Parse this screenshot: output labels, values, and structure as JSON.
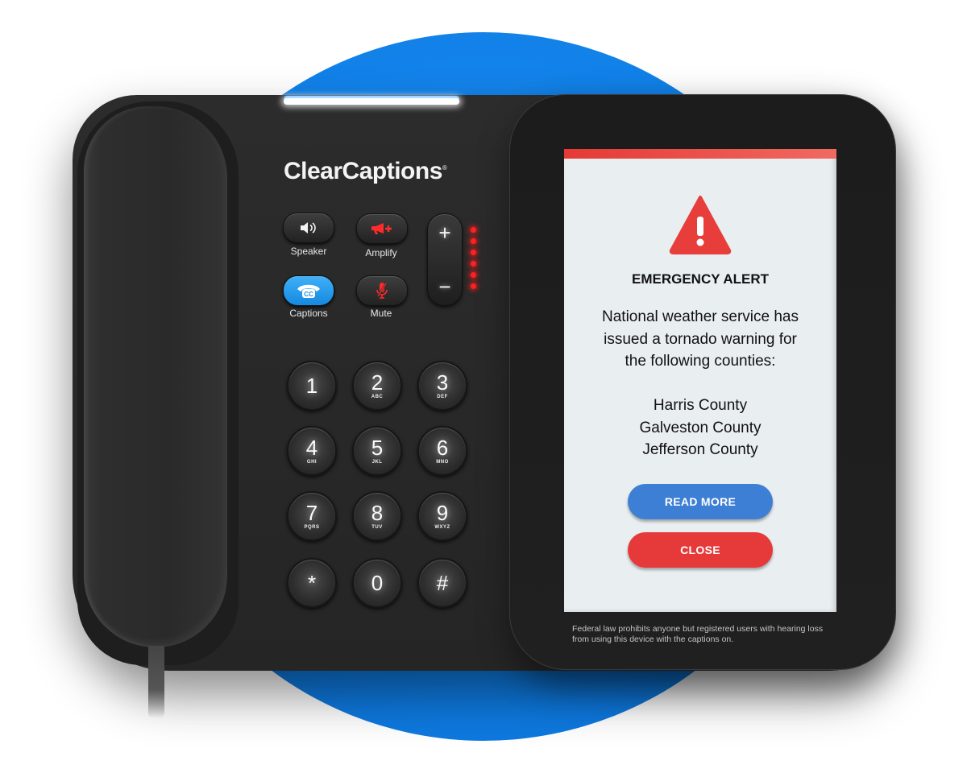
{
  "device": {
    "brand": "ClearCaptions",
    "brand_mark": "®"
  },
  "function_buttons": [
    {
      "id": "speaker",
      "label": "Speaker",
      "icon": "speaker-icon",
      "state": "on-white"
    },
    {
      "id": "amplify",
      "label": "Amplify",
      "icon": "megaphone-plus-icon",
      "state": "active-red"
    },
    {
      "id": "captions",
      "label": "Captions",
      "icon": "cc-phone-icon",
      "state": "active-blue"
    },
    {
      "id": "mute",
      "label": "Mute",
      "icon": "mic-off-icon",
      "state": "active-red"
    }
  ],
  "volume": {
    "plus": "+",
    "minus": "−",
    "led_level": 6,
    "led_max": 6
  },
  "keypad": [
    {
      "digit": "1",
      "letters": ""
    },
    {
      "digit": "2",
      "letters": "ABC"
    },
    {
      "digit": "3",
      "letters": "DEF"
    },
    {
      "digit": "4",
      "letters": "GHI"
    },
    {
      "digit": "5",
      "letters": "JKL"
    },
    {
      "digit": "6",
      "letters": "MNO"
    },
    {
      "digit": "7",
      "letters": "PQRS"
    },
    {
      "digit": "8",
      "letters": "TUV"
    },
    {
      "digit": "9",
      "letters": "WXYZ"
    },
    {
      "digit": "*",
      "letters": ""
    },
    {
      "digit": "0",
      "letters": ""
    },
    {
      "digit": "#",
      "letters": ""
    }
  ],
  "screen": {
    "title": "EMERGENCY ALERT",
    "body": [
      "National weather service has",
      "issued a tornado warning for",
      "the following counties:"
    ],
    "counties": [
      "Harris County",
      "Galveston County",
      "Jefferson County"
    ],
    "read_more_label": "READ MORE",
    "close_label": "CLOSE",
    "legal": "Federal law prohibits anyone but registered users with hearing loss from using this device with the captions on."
  },
  "colors": {
    "background_circle": "#1080e8",
    "alert_red": "#e63a3a",
    "read_more_blue": "#3e7fd6",
    "captions_blue": "#1f95ea",
    "screen_bg": "#e9eef1"
  }
}
